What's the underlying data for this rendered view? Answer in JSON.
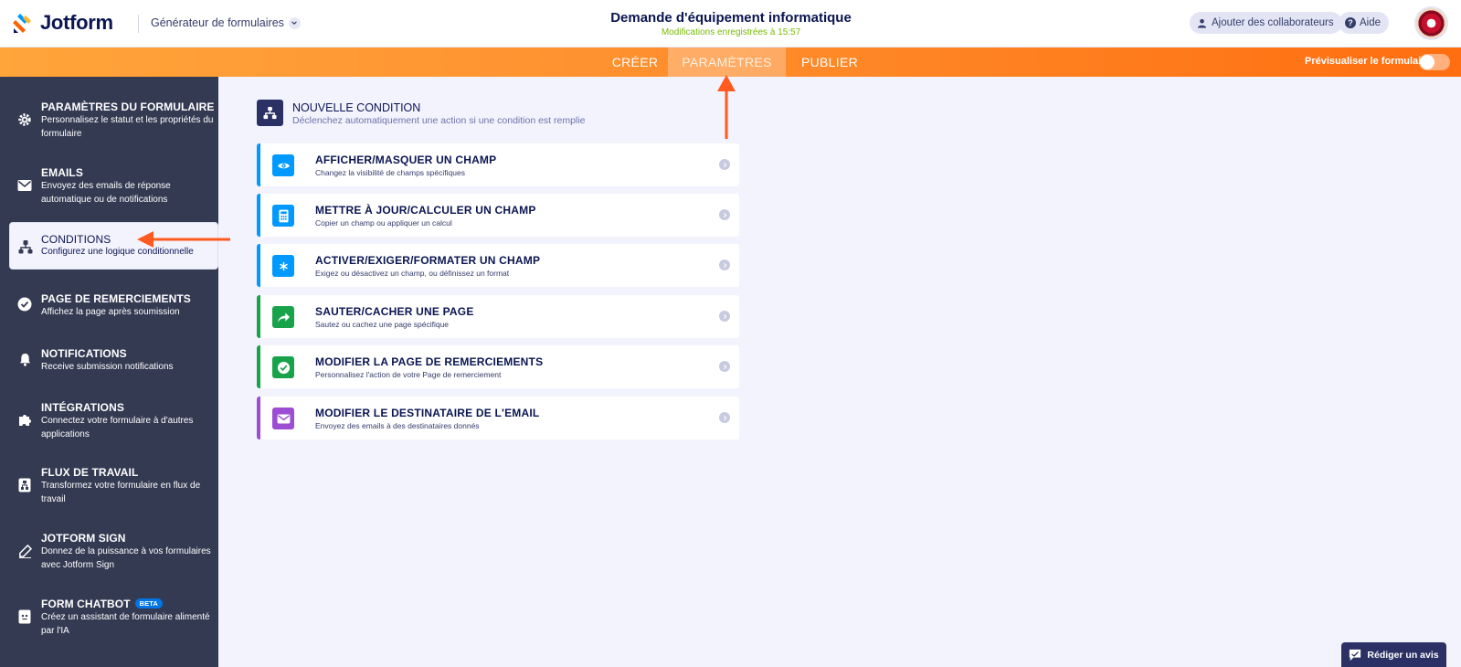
{
  "header": {
    "logo_text": "Jotform",
    "builder_menu": "Générateur de formulaires",
    "form_title": "Demande d'équipement informatique",
    "save_status": "Modifications enregistrées à 15:57",
    "collab_label": "Ajouter des collaborateurs",
    "help_label": "Aide"
  },
  "tabs": [
    {
      "label": "CRÉER"
    },
    {
      "label": "PARAMÈTRES",
      "active": true
    },
    {
      "label": "PUBLIER"
    }
  ],
  "preview_label": "Prévisualiser le formulaire",
  "sidebar": {
    "items": [
      {
        "title": "PARAMÈTRES DU FORMULAIRE",
        "desc": "Personnalisez le statut et les propriétés du formulaire",
        "icon": "gear-icon"
      },
      {
        "title": "EMAILS",
        "desc": "Envoyez des emails de réponse automatique ou de notifications",
        "icon": "envelope-icon"
      },
      {
        "title": "CONDITIONS",
        "desc": "Configurez une logique conditionnelle",
        "icon": "hierarchy-icon",
        "active": true
      },
      {
        "title": "PAGE DE REMERCIEMENTS",
        "desc": "Affichez la page après soumission",
        "icon": "check-circle-icon"
      },
      {
        "title": "NOTIFICATIONS",
        "desc": "Receive submission notifications",
        "icon": "bell-icon"
      },
      {
        "title": "INTÉGRATIONS",
        "desc": "Connectez votre formulaire à d'autres applications",
        "icon": "puzzle-icon"
      },
      {
        "title": "FLUX DE TRAVAIL",
        "desc": "Transformez votre formulaire en flux de travail",
        "icon": "workflow-icon"
      },
      {
        "title": "JOTFORM SIGN",
        "desc": "Donnez de la puissance à vos formulaires avec Jotform Sign",
        "icon": "pen-icon"
      },
      {
        "title": "FORM CHATBOT",
        "badge": "BETA",
        "desc": "Créez un assistant de formulaire alimenté par l'IA",
        "icon": "chatbot-icon"
      }
    ]
  },
  "new_condition": {
    "title": "NOUVELLE CONDITION",
    "desc": "Déclenchez automatiquement une action si une condition est remplie"
  },
  "condition_types": [
    {
      "title": "AFFICHER/MASQUER UN CHAMP",
      "desc": "Changez la visibilité de champs spécifiques",
      "color": "#0099ff",
      "icon": "eye-icon"
    },
    {
      "title": "METTRE À JOUR/CALCULER UN CHAMP",
      "desc": "Copier un champ ou appliquer un calcul",
      "color": "#0099ff",
      "icon": "calculator-icon"
    },
    {
      "title": "ACTIVER/EXIGER/FORMATER UN CHAMP",
      "desc": "Exigez ou désactivez un champ, ou définissez un format",
      "color": "#0099ff",
      "icon": "asterisk-icon"
    },
    {
      "title": "SAUTER/CACHER UNE PAGE",
      "desc": "Sautez ou cachez une page spécifique",
      "color": "#18a34a",
      "icon": "share-arrow-icon"
    },
    {
      "title": "MODIFIER LA PAGE DE REMERCIEMENTS",
      "desc": "Personnalisez l'action de votre Page de remerciement",
      "color": "#18a34a",
      "icon": "check-icon"
    },
    {
      "title": "MODIFIER LE DESTINATAIRE DE L'EMAIL",
      "desc": "Envoyez des emails à des destinataires donnés",
      "color": "#9c4dd3",
      "icon": "mail-icon"
    }
  ],
  "review_label": "Rédiger un avis",
  "colors": {
    "orange_bar": "#ff9230",
    "sidebar_bg": "#343a52",
    "annotation_arrow": "#ff5a1f",
    "navy": "#0a1551"
  }
}
